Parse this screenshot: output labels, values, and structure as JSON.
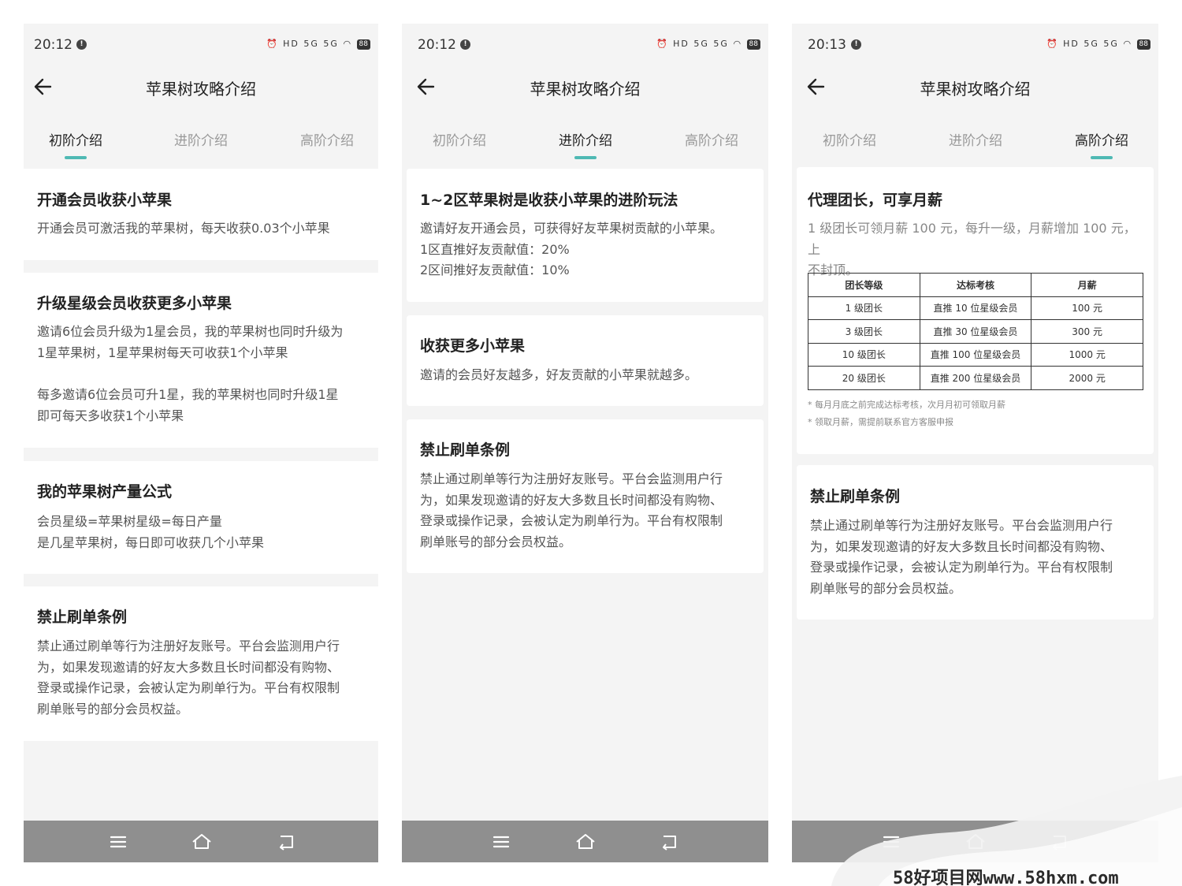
{
  "phones": [
    {
      "status": {
        "time": "20:12",
        "notify": "!",
        "icons": "⏰ HD 5G 5G ◠",
        "battery": "88"
      },
      "nav": {
        "title": "苹果树攻略介绍"
      },
      "tabs": [
        "初阶介绍",
        "进阶介绍",
        "高阶介绍"
      ],
      "active_tab": 0,
      "cards": [
        {
          "title": "开通会员收获小苹果",
          "lines": [
            "开通会员可激活我的苹果树，每天收获0.03个小苹果"
          ]
        },
        {
          "title": "升级星级会员收获更多小苹果",
          "lines": [
            "邀请6位会员升级为1星会员，我的苹果树也同时升级为",
            "1星苹果树，1星苹果树每天可收获1个小苹果",
            "",
            "每多邀请6位会员可升1星，我的苹果树也同时升级1星",
            "即可每天多收获1个小苹果"
          ]
        },
        {
          "title": "我的苹果树产量公式",
          "lines": [
            "会员星级=苹果树星级=每日产量",
            "是几星苹果树，每日即可收获几个小苹果"
          ]
        },
        {
          "title": "禁止刷单条例",
          "lines": [
            "禁止通过刷单等行为注册好友账号。平台会监测用户行",
            "为，如果发现邀请的好友大多数且长时间都没有购物、",
            "登录或操作记录，会被认定为刷单行为。平台有权限制",
            "刷单账号的部分会员权益。"
          ]
        }
      ]
    },
    {
      "status": {
        "time": "20:12",
        "notify": "!",
        "icons": "⏰ HD 5G 5G ◠",
        "battery": "88"
      },
      "nav": {
        "title": "苹果树攻略介绍"
      },
      "tabs": [
        "初阶介绍",
        "进阶介绍",
        "高阶介绍"
      ],
      "active_tab": 1,
      "cards": [
        {
          "title": "1~2区苹果树是收获小苹果的进阶玩法",
          "lines": [
            "邀请好友开通会员，可获得好友苹果树贡献的小苹果。",
            "1区直推好友贡献值：20%",
            "2区间推好友贡献值：10%"
          ]
        },
        {
          "title": "收获更多小苹果",
          "lines": [
            "邀请的会员好友越多，好友贡献的小苹果就越多。"
          ]
        },
        {
          "title": "禁止刷单条例",
          "lines": [
            "禁止通过刷单等行为注册好友账号。平台会监测用户行",
            "为，如果发现邀请的好友大多数且长时间都没有购物、",
            "登录或操作记录，会被认定为刷单行为。平台有权限制",
            "刷单账号的部分会员权益。"
          ]
        }
      ]
    },
    {
      "status": {
        "time": "20:13",
        "notify": "!",
        "icons": "⏰ HD 5G 5G ◠",
        "battery": "88"
      },
      "nav": {
        "title": "苹果树攻略介绍"
      },
      "tabs": [
        "初阶介绍",
        "进阶介绍",
        "高阶介绍"
      ],
      "active_tab": 2,
      "cards": [
        {
          "title": "代理团长，可享月薪",
          "lines": [
            "1 级团长可领月薪 100 元，每升一级，月薪增加 100 元，上",
            "不封顶。"
          ],
          "table": {
            "headers": [
              "团长等级",
              "达标考核",
              "月薪"
            ],
            "rows": [
              [
                "1 级团长",
                "直推 10 位星级会员",
                "100 元"
              ],
              [
                "3 级团长",
                "直推 30 位星级会员",
                "300 元"
              ],
              [
                "10 级团长",
                "直推 100 位星级会员",
                "1000 元"
              ],
              [
                "20 级团长",
                "直推 200 位星级会员",
                "2000 元"
              ]
            ]
          },
          "notes": [
            "* 每月月底之前完成达标考核，次月月初可领取月薪",
            "* 领取月薪，需提前联系官方客服申报"
          ]
        },
        {
          "title": "禁止刷单条例",
          "lines": [
            "禁止通过刷单等行为注册好友账号。平台会监测用户行",
            "为，如果发现邀请的好友大多数且长时间都没有购物、",
            "登录或操作记录，会被认定为刷单行为。平台有权限制",
            "刷单账号的部分会员权益。"
          ]
        }
      ]
    }
  ],
  "watermark": {
    "text": "58好项目网www.58hxm.com"
  }
}
